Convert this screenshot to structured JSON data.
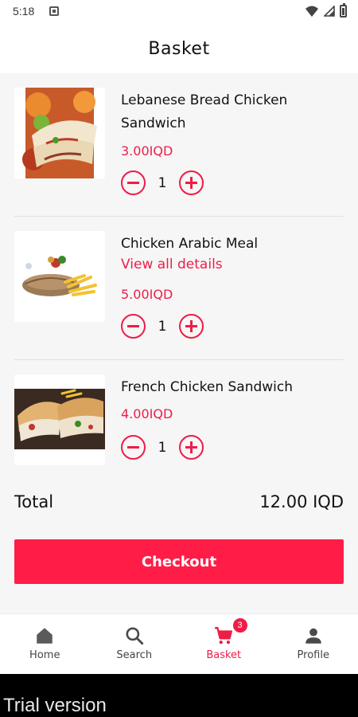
{
  "status_bar": {
    "time": "5:18"
  },
  "header": {
    "title": "Basket"
  },
  "cart": {
    "items": [
      {
        "name": "Lebanese Bread Chicken Sandwich",
        "details_link": "",
        "price": "3.00IQD",
        "quantity": "1"
      },
      {
        "name": "Chicken Arabic Meal",
        "details_link": "View all details",
        "price": "5.00IQD",
        "quantity": "1"
      },
      {
        "name": "French Chicken Sandwich",
        "details_link": "",
        "price": "4.00IQD",
        "quantity": "1"
      }
    ]
  },
  "summary": {
    "total_label": "Total",
    "total_value": "12.00 IQD"
  },
  "checkout": {
    "label": "Checkout"
  },
  "bottom_nav": {
    "items": [
      {
        "label": "Home",
        "icon": "home-icon"
      },
      {
        "label": "Search",
        "icon": "search-icon"
      },
      {
        "label": "Basket",
        "icon": "cart-icon",
        "badge": "3",
        "active": true
      },
      {
        "label": "Profile",
        "icon": "person-icon"
      }
    ]
  },
  "watermark": {
    "text": "Trial version"
  },
  "colors": {
    "accent": "#ee1d48",
    "checkout": "#ff1d48",
    "background": "#f6f6f6"
  }
}
